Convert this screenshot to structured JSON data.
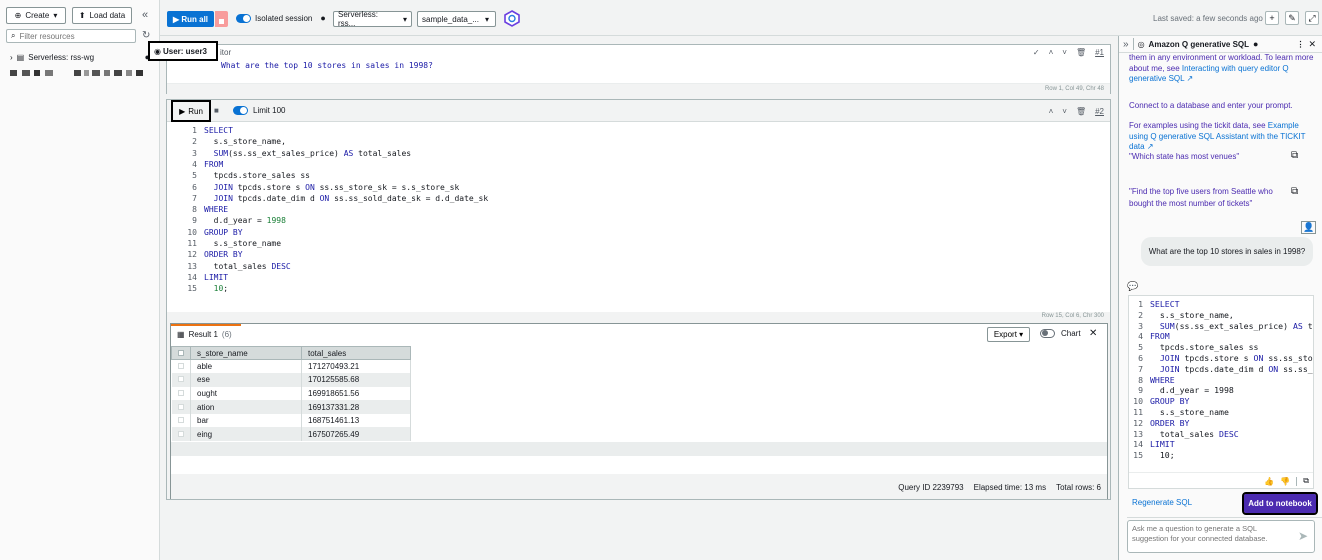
{
  "left_panel": {
    "create_label": "Create",
    "load_data_label": "Load data",
    "filter_placeholder": "Filter resources",
    "tree_item": "Serverless: rss-wg"
  },
  "toolbar": {
    "run_all": "Run all",
    "isolated_session": "Isolated session",
    "connection": "Serverless: rss...",
    "database": "sample_data_...",
    "last_saved": "Last saved: a few seconds ago"
  },
  "cell1": {
    "user_badge": "User: user3",
    "label_fragment": "itor",
    "prompt": "What are the top 10 stores in sales in 1998?",
    "status": "Row 1, Col 49, Chr 48",
    "number": "#1"
  },
  "cell2": {
    "run": "Run",
    "limit_label": "Limit 100",
    "number": "#2",
    "status": "Row 15, Col 6, Chr 300",
    "line_numbers": [
      "1",
      "2",
      "3",
      "4",
      "5",
      "6",
      "7",
      "8",
      "9",
      "10",
      "11",
      "12",
      "13",
      "14",
      "15"
    ]
  },
  "results": {
    "tab": "Result 1",
    "tab_count": "(6)",
    "export": "Export",
    "chart": "Chart",
    "columns": [
      "s_store_name",
      "total_sales"
    ],
    "rows": [
      [
        "able",
        "171270493.21"
      ],
      [
        "ese",
        "170125585.68"
      ],
      [
        "ought",
        "169918651.56"
      ],
      [
        "ation",
        "169137331.28"
      ],
      [
        "bar",
        "168751461.13"
      ],
      [
        "eing",
        "167507265.49"
      ]
    ],
    "query_id": "Query ID 2239793",
    "elapsed": "Elapsed time: 13 ms",
    "total_rows": "Total rows: 6"
  },
  "assistant": {
    "title": "Amazon Q generative SQL",
    "intro_prefix": "them in any environment or workload. To learn more about me, see ",
    "intro_link": "Interacting with query editor Q generative SQL",
    "connect": "Connect to a database and enter your prompt.",
    "examples_prefix": "For examples using the tickit data, see ",
    "examples_link": "Example using Q generative SQL Assistant with the TICKIT data",
    "suggestion1": "\"Which state has most venues\"",
    "suggestion2": "\"Find the top five users from Seattle who bought the most number of tickets\"",
    "user_question": "What are the top 10 stores in sales in 1998?",
    "line_numbers": [
      "1",
      "2",
      "3",
      "4",
      "5",
      "6",
      "7",
      "8",
      "9",
      "10",
      "11",
      "12",
      "13",
      "14",
      "15"
    ],
    "regenerate": "Regenerate SQL",
    "add_to_notebook": "Add to notebook",
    "input_placeholder": "Ask me a question to generate a SQL suggestion for your connected database."
  }
}
